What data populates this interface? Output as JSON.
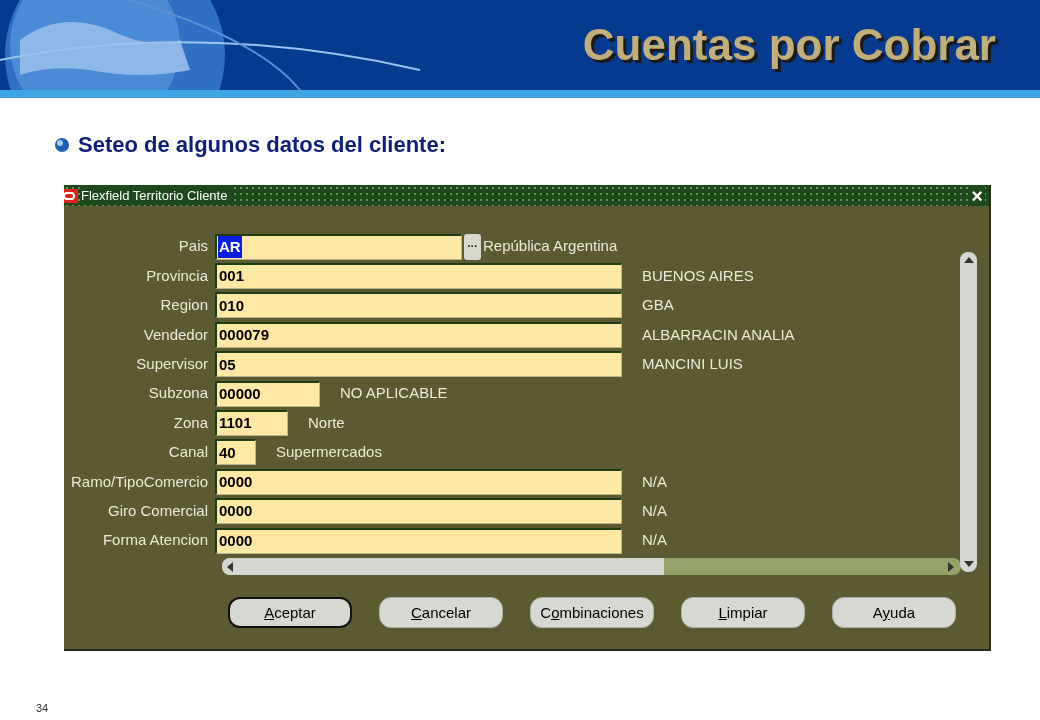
{
  "slide": {
    "title": "Cuentas por Cobrar",
    "bullet": "Seteo de algunos datos del cliente:",
    "page_number": "34"
  },
  "window": {
    "title": "Flexfield Territorio Cliente",
    "close": "×",
    "fields": [
      {
        "label": "Pais",
        "value": "AR",
        "kind": "lov",
        "focused": true,
        "lov_button": "···",
        "description": "República Argentina"
      },
      {
        "label": "Provincia",
        "value": "001",
        "kind": "full",
        "focused": false,
        "description": "BUENOS AIRES"
      },
      {
        "label": "Region",
        "value": "010",
        "kind": "full",
        "focused": false,
        "description": "GBA"
      },
      {
        "label": "Vendedor",
        "value": "000079",
        "kind": "full",
        "focused": false,
        "description": "ALBARRACIN ANALIA"
      },
      {
        "label": "Supervisor",
        "value": "05",
        "kind": "full",
        "focused": false,
        "description": "MANCINI LUIS"
      },
      {
        "label": "Subzona",
        "value": "00000",
        "kind": "medium",
        "focused": false,
        "description": "NO APLICABLE"
      },
      {
        "label": "Zona",
        "value": "1101",
        "kind": "small",
        "focused": false,
        "description": "Norte"
      },
      {
        "label": "Canal",
        "value": "40",
        "kind": "tiny",
        "focused": false,
        "description": "Supermercados"
      },
      {
        "label": "Ramo/TipoComercio",
        "value": "0000",
        "kind": "full",
        "focused": false,
        "description": "N/A"
      },
      {
        "label": "Giro Comercial",
        "value": "0000",
        "kind": "full",
        "focused": false,
        "description": "N/A"
      },
      {
        "label": "Forma Atencion",
        "value": "0000",
        "kind": "full",
        "focused": false,
        "description": "N/A"
      }
    ],
    "buttons": [
      {
        "label": "Aceptar",
        "mnemonic_on_second_letter": false,
        "default": true
      },
      {
        "label": "Cancelar",
        "mnemonic_on_second_letter": false,
        "default": false
      },
      {
        "label": "Combinaciones",
        "mnemonic_on_second_letter": true,
        "default": false
      },
      {
        "label": "Limpiar",
        "mnemonic_on_second_letter": false,
        "default": false
      },
      {
        "label": "Ayuda",
        "mnemonic_on_second_letter": true,
        "default": false
      }
    ]
  }
}
